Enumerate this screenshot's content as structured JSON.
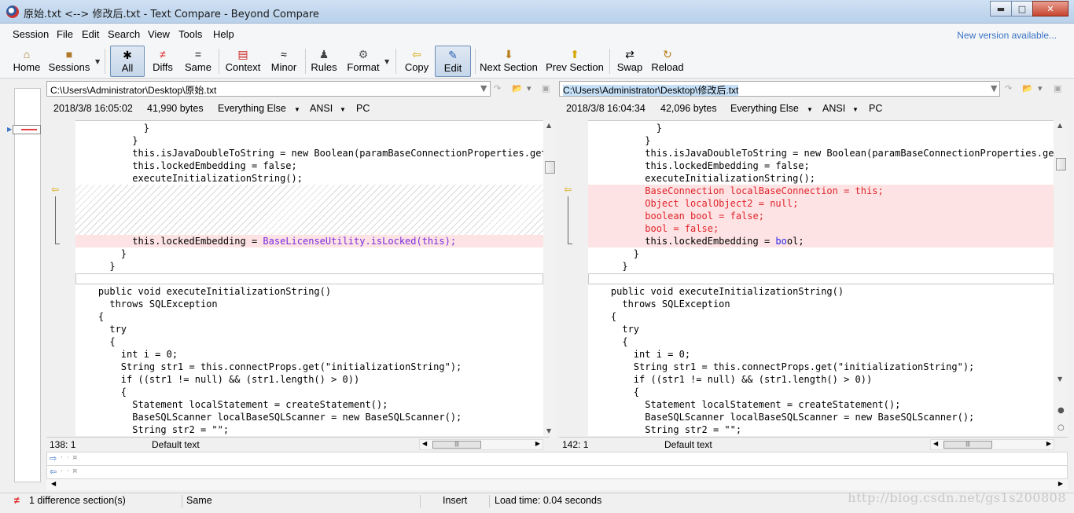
{
  "window": {
    "title": "原始.txt <--> 修改后.txt - Text Compare - Beyond Compare",
    "minimize": "▬",
    "maximize": "□",
    "close": "✕"
  },
  "menu": {
    "items": [
      "Session",
      "File",
      "Edit",
      "Search",
      "View",
      "Tools",
      "Help"
    ],
    "new_version": "New version available..."
  },
  "toolbar": {
    "home": "Home",
    "sessions": "Sessions",
    "all": "All",
    "diffs": "Diffs",
    "same": "Same",
    "context": "Context",
    "minor": "Minor",
    "rules": "Rules",
    "format": "Format",
    "copy": "Copy",
    "edit": "Edit",
    "next_section": "Next Section",
    "prev_section": "Prev Section",
    "swap": "Swap",
    "reload": "Reload"
  },
  "left": {
    "path": "C:\\Users\\Administrator\\Desktop\\原始.txt",
    "date": "2018/3/8 16:05:02",
    "size": "41,990 bytes",
    "filter": "Everything Else",
    "encoding": "ANSI",
    "line_ending": "PC",
    "position": "138: 1",
    "text_type": "Default text",
    "lines": [
      "            }",
      "          }",
      "          this.isJavaDoubleToString = new Boolean(paramBaseConnectionProperties.get(\"java",
      "          this.lockedEmbedding = false;",
      "          executeInitializationString();",
      "",
      "",
      "",
      "          this.lockedEmbedding = ",
      "        }",
      "      }",
      "",
      "    public void executeInitializationString()",
      "      throws SQLException",
      "    {",
      "      try",
      "      {",
      "        int i = 0;",
      "        String str1 = this.connectProps.get(\"initializationString\");",
      "        if ((str1 != null) && (str1.length() > 0))",
      "        {",
      "          Statement localStatement = createStatement();",
      "          BaseSQLScanner localBaseSQLScanner = new BaseSQLScanner();",
      "          String str2 = \"\";"
    ],
    "diff_tail": "BaseLicenseUtility.isLocked(this);"
  },
  "right": {
    "path": "C:\\Users\\Administrator\\Desktop\\修改后.txt",
    "date": "2018/3/8 16:04:34",
    "size": "42,096 bytes",
    "filter": "Everything Else",
    "encoding": "ANSI",
    "line_ending": "PC",
    "position": "142: 1",
    "text_type": "Default text",
    "lines": [
      "            }",
      "          }",
      "          this.isJavaDoubleToString = new Boolean(paramBaseConnectionProperties.get(\"java",
      "          this.lockedEmbedding = false;",
      "          executeInitializationString();",
      "          BaseConnection localBaseConnection = this;",
      "          Object localObject2 = null;",
      "          boolean bool = false;",
      "          bool = false;",
      "          this.lockedEmbedding = ",
      "        }",
      "      }",
      "",
      "    public void executeInitializationString()",
      "      throws SQLException",
      "    {",
      "      try",
      "      {",
      "        int i = 0;",
      "        String str1 = this.connectProps.get(\"initializationString\");",
      "        if ((str1 != null) && (str1.length() > 0))",
      "        {",
      "          Statement localStatement = createStatement();",
      "          BaseSQLScanner localBaseSQLScanner = new BaseSQLScanner();",
      "          String str2 = \"\";"
    ],
    "diff_tail_a": "bo",
    "diff_tail_b": "ol;"
  },
  "status": {
    "differences": "1 difference section(s)",
    "same": "Same",
    "mode": "Insert",
    "load_time": "Load time: 0.04 seconds"
  },
  "watermark": "http://blog.csdn.net/gs1s200808"
}
